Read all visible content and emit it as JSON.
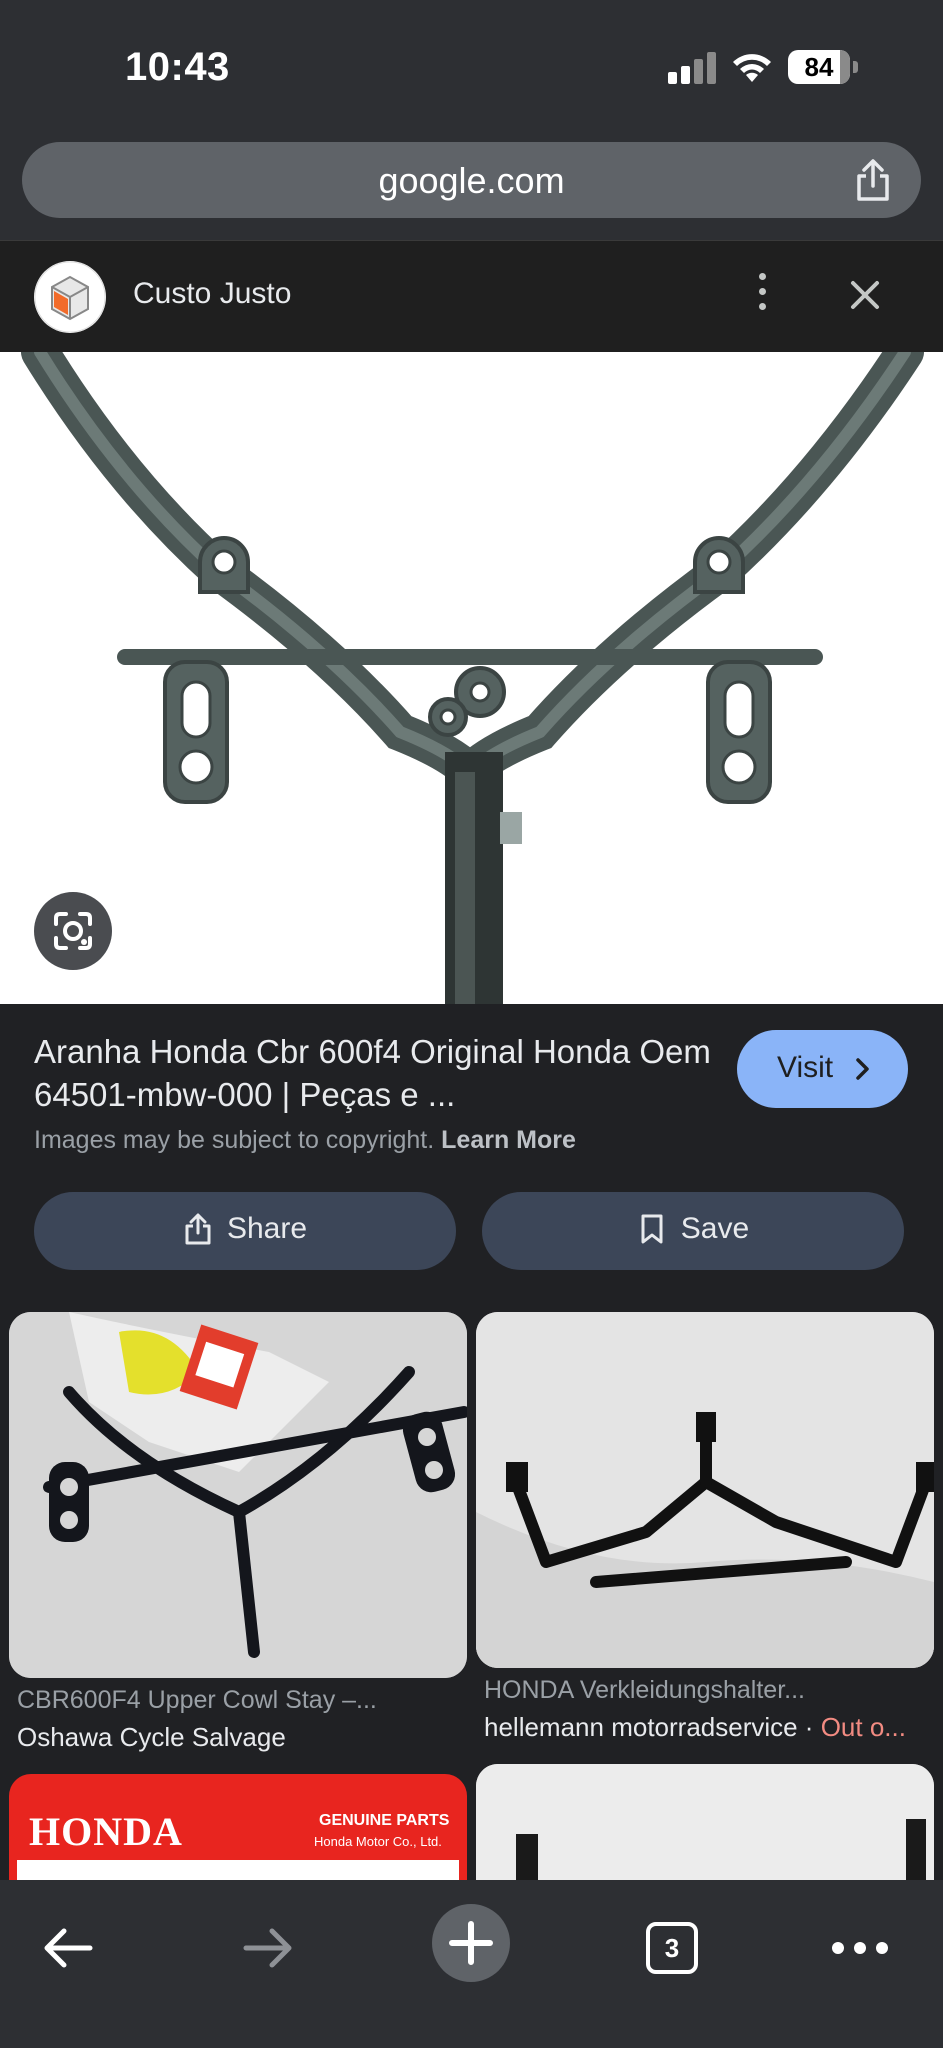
{
  "status_bar": {
    "time": "10:43",
    "battery": "84"
  },
  "url_bar": {
    "url": "google.com"
  },
  "panel": {
    "site_name": "Custo Justo"
  },
  "result": {
    "title": "Aranha Honda Cbr 600f4 Original Honda Oem 64501-mbw-000 | Peças e ...",
    "visit_label": "Visit",
    "copyright_text": "Images may be subject to copyright.",
    "learn_more": "Learn More",
    "share_label": "Share",
    "save_label": "Save"
  },
  "related": [
    {
      "title": "CBR600F4 Upper Cowl Stay –...",
      "source": "Oshawa Cycle Salvage"
    },
    {
      "title": "HONDA Verkleidungshalter...",
      "source": "hellemann motorradservice ·",
      "status": "Out o..."
    },
    {
      "brand": "HONDA",
      "badge_line1": "GENUINE PARTS",
      "badge_line2": "Honda Motor Co., Ltd."
    },
    {}
  ],
  "bottom_nav": {
    "tab_count": "3"
  },
  "colors": {
    "accent": "#8ab4f8",
    "out_of_stock": "#f28b82",
    "background": "#202124"
  }
}
